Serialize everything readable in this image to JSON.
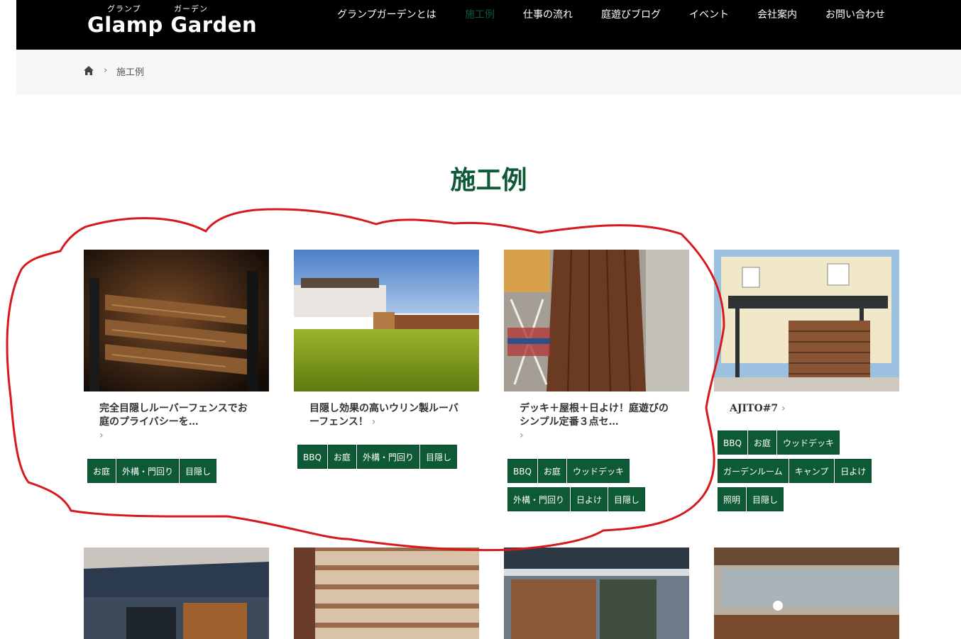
{
  "header": {
    "logo_ruby_1": "グランプ",
    "logo_ruby_2": "ガーデン",
    "logo_text": "Glamp Garden",
    "nav": [
      "グランプガーデンとは",
      "施工例",
      "仕事の流れ",
      "庭遊びブログ",
      "イベント",
      "会社案内",
      "お問い合わせ"
    ],
    "active_nav_index": 1
  },
  "breadcrumb": {
    "home_icon": "home-icon",
    "separator": "›",
    "current": "施工例"
  },
  "page_title": "施工例",
  "cards": [
    {
      "title": "完全目隠しルーバーフェンスでお庭のプライバシーを…",
      "chevron": "›",
      "tags": [
        "お庭",
        "外構・門回り",
        "目隠し"
      ]
    },
    {
      "title": "目隠し効果の高いウリン製ルーバーフェンス！",
      "chevron": "›",
      "tags": [
        "BBQ",
        "お庭",
        "外構・門回り",
        "目隠し"
      ]
    },
    {
      "title": "デッキ＋屋根＋日よけ！庭遊びのシンプル定番３点セ…",
      "chevron": "›",
      "tags": [
        "BBQ",
        "お庭",
        "ウッドデッキ",
        "外構・門回り",
        "日よけ",
        "目隠し"
      ]
    },
    {
      "title": "AJITO#7",
      "chevron": "›",
      "tags": [
        "BBQ",
        "お庭",
        "ウッドデッキ",
        "ガーデンルーム",
        "キャンプ",
        "日よけ",
        "照明",
        "目隠し"
      ]
    }
  ],
  "colors": {
    "brand_green": "#0e5a37",
    "header_bg": "#000000",
    "crumb_bg": "#f7f7f7",
    "annotation_red": "#d7191c"
  }
}
